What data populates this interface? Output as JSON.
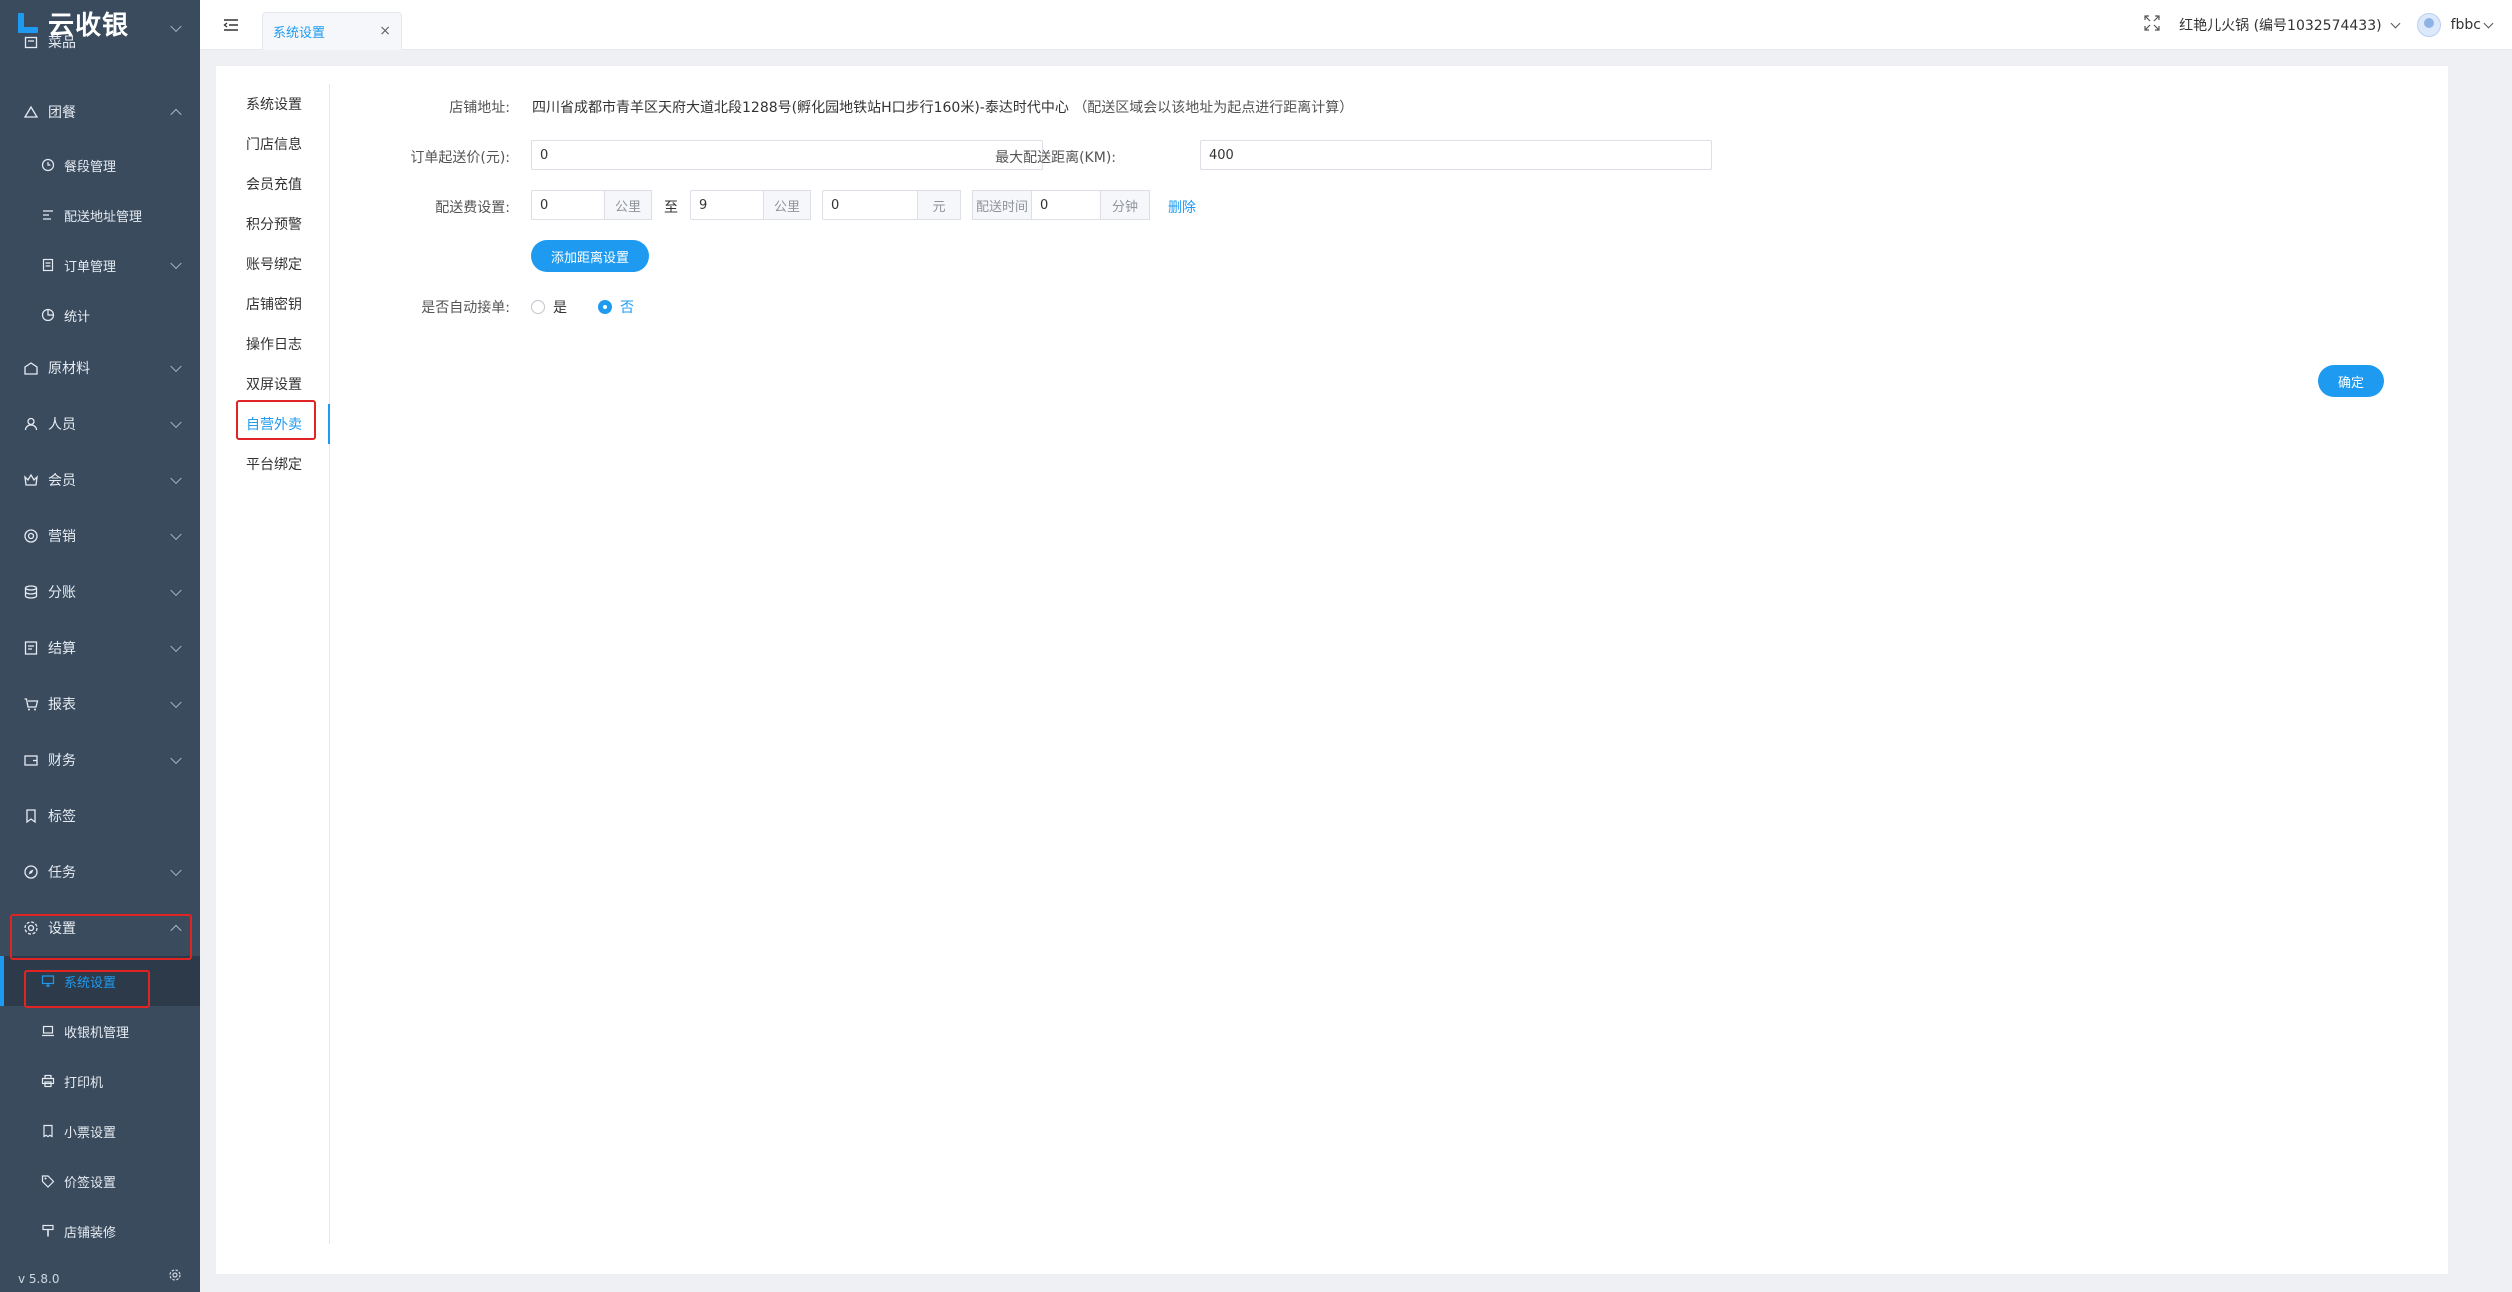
{
  "app": {
    "logo_text": "云收银",
    "version": "v 5.8.0"
  },
  "sidebar": {
    "items": [
      {
        "label": "菜品",
        "icon": "dish-icon"
      },
      {
        "label": "团餐",
        "icon": "group-meal-icon"
      },
      {
        "label": "餐段管理",
        "icon": "clock-icon"
      },
      {
        "label": "配送地址管理",
        "icon": "address-icon"
      },
      {
        "label": "订单管理",
        "icon": "order-icon"
      },
      {
        "label": "统计",
        "icon": "pie-chart-icon"
      },
      {
        "label": "原材料",
        "icon": "warehouse-icon"
      },
      {
        "label": "人员",
        "icon": "user-icon"
      },
      {
        "label": "会员",
        "icon": "crown-icon"
      },
      {
        "label": "营销",
        "icon": "marketing-icon"
      },
      {
        "label": "分账",
        "icon": "database-icon"
      },
      {
        "label": "结算",
        "icon": "settlement-icon"
      },
      {
        "label": "报表",
        "icon": "cart-icon"
      },
      {
        "label": "财务",
        "icon": "wallet-icon"
      },
      {
        "label": "标签",
        "icon": "bookmark-icon"
      },
      {
        "label": "任务",
        "icon": "compass-icon"
      },
      {
        "label": "设置",
        "icon": "gear-icon"
      },
      {
        "label": "系统设置",
        "icon": "monitor-icon"
      },
      {
        "label": "收银机管理",
        "icon": "laptop-icon"
      },
      {
        "label": "打印机",
        "icon": "printer-icon"
      },
      {
        "label": "小票设置",
        "icon": "receipt-icon"
      },
      {
        "label": "价签设置",
        "icon": "price-tag-icon"
      },
      {
        "label": "店铺装修",
        "icon": "brush-icon"
      }
    ]
  },
  "header": {
    "tab_label": "系统设置",
    "tab_close": "×",
    "store_name": "红艳儿火锅 (编号1032574433)",
    "user_name": "fbbc"
  },
  "inner_nav": {
    "items": [
      "系统设置",
      "门店信息",
      "会员充值",
      "积分预警",
      "账号绑定",
      "店铺密钥",
      "操作日志",
      "双屏设置",
      "自营外卖",
      "平台绑定"
    ],
    "active": "自营外卖"
  },
  "form": {
    "address_label": "店铺地址:",
    "address_value": "四川省成都市青羊区天府大道北段1288号(孵化园地铁站H口步行160米)-泰达时代中心",
    "address_hint": "（配送区域会以该地址为起点进行距离计算）",
    "min_order_label": "订单起送价(元):",
    "min_order_value": "0",
    "max_distance_label": "最大配送距离(KM):",
    "max_distance_value": "400",
    "fee_label": "配送费设置:",
    "fee_row": {
      "from_km": "0",
      "km_unit": "公里",
      "to_text": "至",
      "to_km": "9",
      "fee": "0",
      "fee_unit": "元",
      "time_label": "配送时间",
      "time_value": "0",
      "time_unit": "分钟",
      "delete_label": "删除"
    },
    "add_distance_button": "添加距离设置",
    "auto_accept_label": "是否自动接单:",
    "auto_accept_options": [
      "是",
      "否"
    ],
    "auto_accept_selected": "否",
    "confirm_button": "确定"
  },
  "colors": {
    "accent": "#1e9bf0",
    "sidebar_bg": "#3a4b5e",
    "highlight_box": "#e02424"
  }
}
